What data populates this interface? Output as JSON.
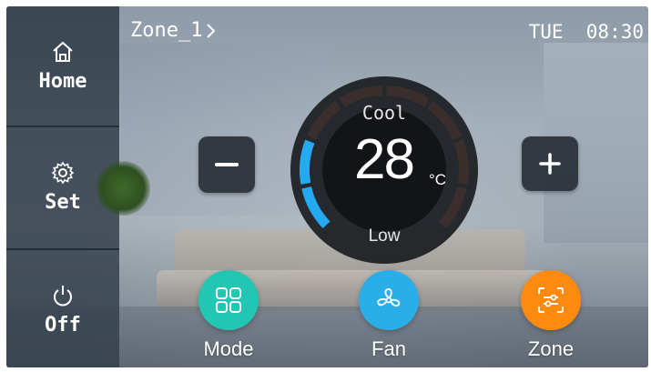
{
  "header": {
    "zone": "Zone_1",
    "datetime": "TUE  08:30"
  },
  "sidebar": {
    "items": [
      {
        "label": "Home"
      },
      {
        "label": "Set"
      },
      {
        "label": "Off"
      }
    ]
  },
  "thermostat": {
    "mode": "Cool",
    "temperature": "28",
    "unit": "°C",
    "fan_speed": "Low",
    "level": 0.2
  },
  "bottom": {
    "items": [
      {
        "label": "Mode",
        "color": "#22c7b4"
      },
      {
        "label": "Fan",
        "color": "#2aaee8"
      },
      {
        "label": "Zone",
        "color": "#ff8a10"
      }
    ]
  },
  "colors": {
    "accent": "#24aaf0",
    "dial_bg": "#121417"
  }
}
